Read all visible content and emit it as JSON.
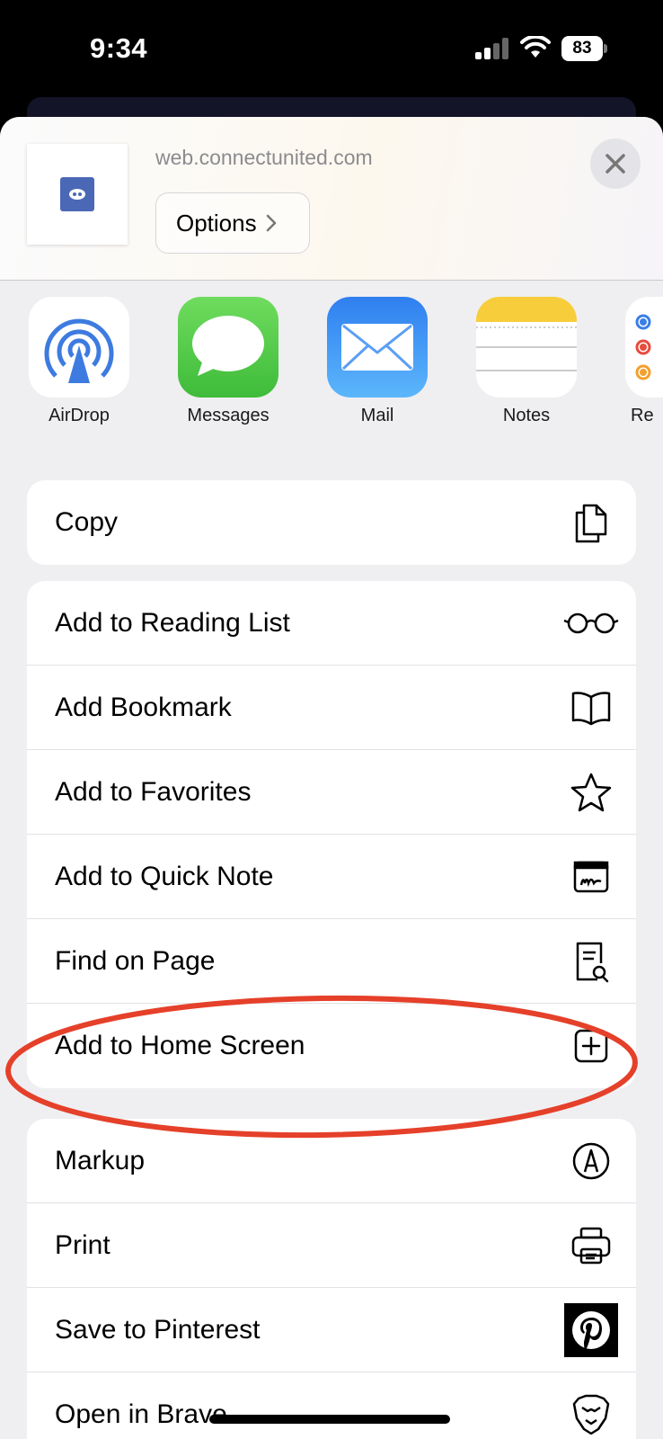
{
  "status_bar": {
    "time": "9:34",
    "battery": "83"
  },
  "share_sheet": {
    "url": "web.connectunited.com",
    "options_label": "Options",
    "apps": [
      {
        "name": "AirDrop",
        "icon": "airdrop-icon"
      },
      {
        "name": "Messages",
        "icon": "messages-icon"
      },
      {
        "name": "Mail",
        "icon": "mail-icon"
      },
      {
        "name": "Notes",
        "icon": "notes-icon"
      },
      {
        "name": "Re",
        "icon": "reminders-icon"
      }
    ],
    "groups": [
      [
        {
          "label": "Copy",
          "icon": "copy-icon"
        }
      ],
      [
        {
          "label": "Add to Reading List",
          "icon": "glasses-icon"
        },
        {
          "label": "Add Bookmark",
          "icon": "book-icon"
        },
        {
          "label": "Add to Favorites",
          "icon": "star-icon"
        },
        {
          "label": "Add to Quick Note",
          "icon": "quick-note-icon"
        },
        {
          "label": "Find on Page",
          "icon": "find-doc-icon"
        },
        {
          "label": "Add to Home Screen",
          "icon": "plus-square-icon"
        }
      ],
      [
        {
          "label": "Markup",
          "icon": "markup-icon"
        },
        {
          "label": "Print",
          "icon": "printer-icon"
        },
        {
          "label": "Save to Pinterest",
          "icon": "pinterest-icon"
        },
        {
          "label": "Open in Brave",
          "icon": "brave-lion-icon"
        }
      ]
    ]
  },
  "annotation": {
    "highlight_color": "#e5402a",
    "highlighted_item": "Add to Home Screen"
  }
}
